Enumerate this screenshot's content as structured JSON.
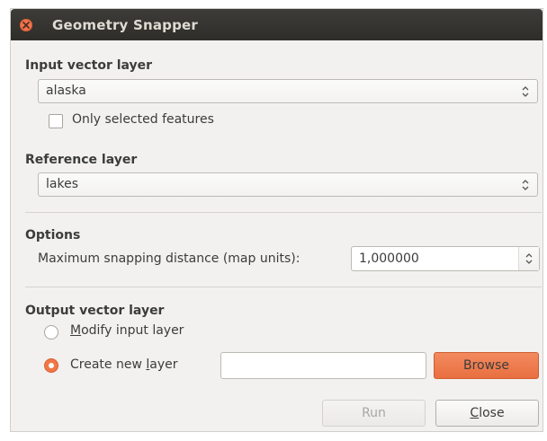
{
  "window": {
    "title": "Geometry Snapper"
  },
  "input_layer": {
    "heading": "Input vector layer",
    "selected": "alaska",
    "only_selected_label": "Only selected features",
    "only_selected_checked": false
  },
  "reference_layer": {
    "heading": "Reference layer",
    "selected": "lakes"
  },
  "options": {
    "heading": "Options",
    "distance_label": "Maximum snapping distance (map units):",
    "distance_value": "1,000000"
  },
  "output_layer": {
    "heading": "Output vector layer",
    "modify_label_pre": "",
    "modify_label_mnemonic": "M",
    "modify_label_post": "odify input layer",
    "create_label_pre": "Create new ",
    "create_label_mnemonic": "l",
    "create_label_post": "ayer",
    "selected_option": "Create new layer",
    "output_path": "",
    "browse_label": "Browse"
  },
  "buttons": {
    "run_label": "Run",
    "close_mnemonic": "C",
    "close_rest": "lose"
  },
  "colors": {
    "accent": "#f07746",
    "titlebar": "#3d3c38",
    "window_bg": "#f2f1f0"
  },
  "icons": {
    "close": "close-icon",
    "combo_arrows": "updown-arrows-icon",
    "spin_arrows": "spin-arrows-icon"
  }
}
